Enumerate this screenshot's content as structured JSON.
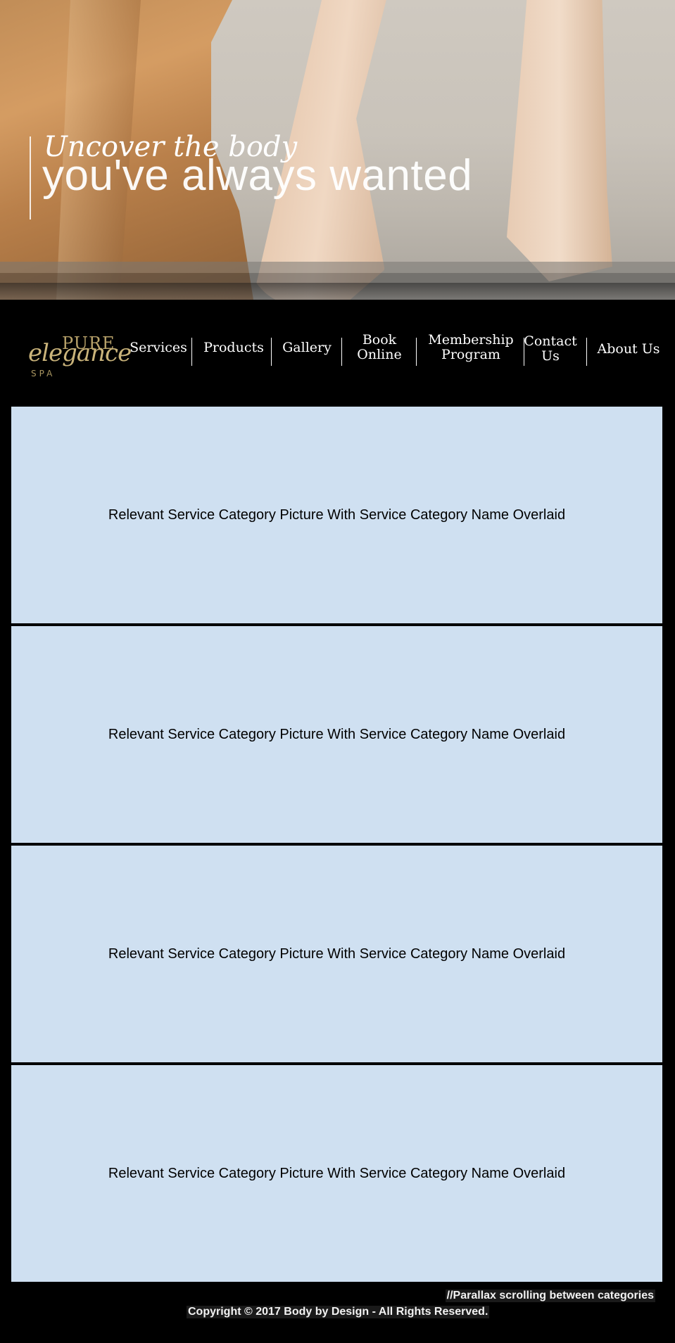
{
  "hero": {
    "tagline": "Uncover the body",
    "headline": "you've always wanted"
  },
  "logo": {
    "top": "PURE",
    "middle": "elegance",
    "bottom": "SPA"
  },
  "nav": {
    "items": [
      {
        "label": "Services"
      },
      {
        "label": "Products"
      },
      {
        "label": "Gallery"
      },
      {
        "label": "Book\nOnline"
      },
      {
        "label": "Membership\nProgram"
      },
      {
        "label": "Contact\nUs"
      },
      {
        "label": "About Us"
      }
    ]
  },
  "categories": [
    {
      "label": "Relevant Service Category Picture With Service Category Name Overlaid"
    },
    {
      "label": "Relevant Service Category Picture With Service Category Name Overlaid"
    },
    {
      "label": "Relevant Service Category Picture With Service Category Name Overlaid"
    },
    {
      "label": "Relevant Service Category Picture With Service Category Name Overlaid"
    }
  ],
  "footer": {
    "note": "//Parallax scrolling between categories",
    "copyright": "Copyright © 2017 Body by Design - All Rights Reserved."
  },
  "colors": {
    "background": "#000000",
    "panel": "#cfe0f1",
    "logo_gold": "#c9b37a"
  }
}
